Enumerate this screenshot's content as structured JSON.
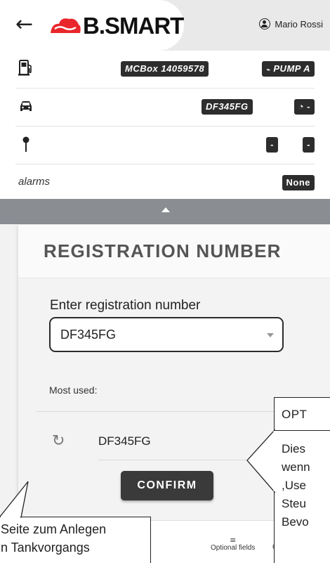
{
  "header": {
    "back_label": "←",
    "brand": "B.SMART",
    "user_name": "Mario Rossi"
  },
  "rows": {
    "pump_box": "MCBox 14059578",
    "pump_name": "PUMP A",
    "vehicle_plate": "DF345FG",
    "odometer": "-",
    "location_a": "-",
    "location_b": "-",
    "alarms_label": "alarms",
    "alarms_value": "None"
  },
  "card": {
    "title": "REGISTRATION NUMBER",
    "field_label": "Enter registration number",
    "selected_value": "DF345FG",
    "most_used_label": "Most used:",
    "recent_items": [
      "DF345FG"
    ],
    "confirm_label": "CONFIRM"
  },
  "bottom_nav": {
    "optional_fields": "Optional fields",
    "truncated": "Q"
  },
  "callouts": {
    "left_lines": [
      "Seite zum Anlegen",
      "n Tankvorgangs"
    ],
    "right_title": "OPT",
    "right_lines": [
      "Dies",
      "wenn",
      ",Use",
      "Steu",
      "Bevo"
    ]
  },
  "colors": {
    "brand_red": "#e8262b",
    "dark": "#2d2d2d",
    "collapse_bar": "#8a8d92"
  },
  "icons": [
    "back-arrow-icon",
    "user-circle-icon",
    "fuel-pump-icon",
    "car-icon",
    "location-pin-icon",
    "gauge-icon",
    "refresh-icon",
    "list-icon"
  ]
}
